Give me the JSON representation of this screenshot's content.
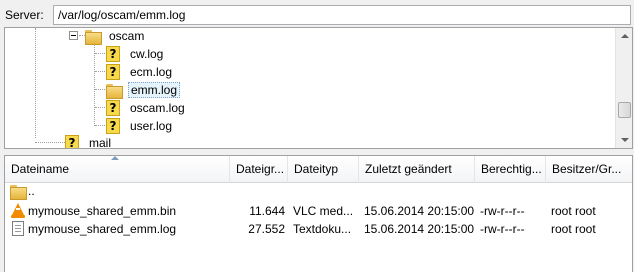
{
  "path_bar": {
    "label": "Server:",
    "value": "/var/log/oscam/emm.log"
  },
  "tree": {
    "folder": "oscam",
    "files": [
      {
        "label": "cw.log",
        "selected": false
      },
      {
        "label": "ecm.log",
        "selected": false
      },
      {
        "label": "emm.log",
        "selected": true
      },
      {
        "label": "oscam.log",
        "selected": false
      },
      {
        "label": "user.log",
        "selected": false
      }
    ],
    "sibling": "mail"
  },
  "file_list": {
    "columns": [
      "Dateiname",
      "Dateigr...",
      "Dateityp",
      "Zuletzt geändert",
      "Berechtig...",
      "Besitzer/Gr..."
    ],
    "parent_dir": "..",
    "rows": [
      {
        "icon": "vlc-icon",
        "name": "mymouse_shared_emm.bin",
        "size": "11.644",
        "type": "VLC med...",
        "modified": "15.06.2014 20:15:00",
        "perms": "-rw-r--r--",
        "owner": "root root"
      },
      {
        "icon": "text-document-icon",
        "name": "mymouse_shared_emm.log",
        "size": "27.552",
        "type": "Textdoku...",
        "modified": "15.06.2014 20:15:00",
        "perms": "-rw-r--r--",
        "owner": "root root"
      }
    ]
  },
  "colors": {
    "selection": "#e5f3fb",
    "folder": "#e6b43d",
    "unknown_file_icon": "#f7d94c",
    "vlc": "#f28a00"
  }
}
